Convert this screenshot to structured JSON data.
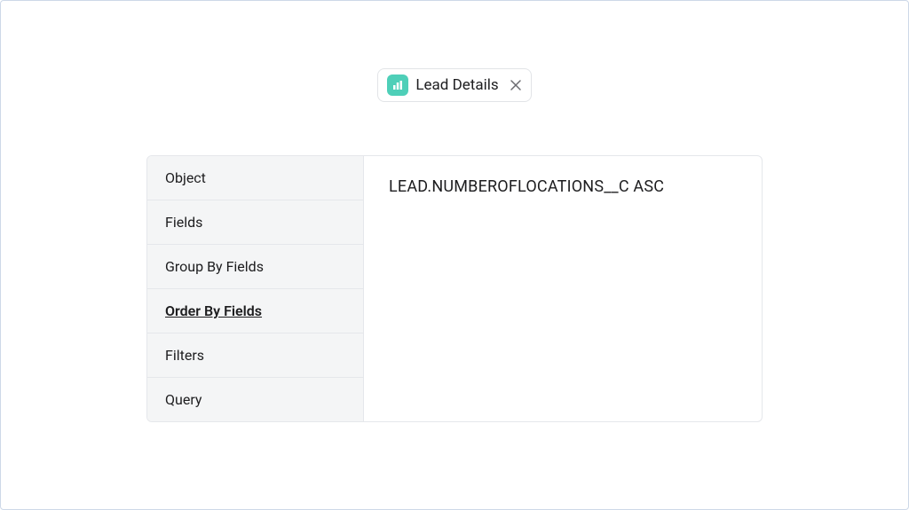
{
  "chip": {
    "label": "Lead Details",
    "icon_name": "chart-icon"
  },
  "sidebar": {
    "items": [
      {
        "label": "Object",
        "active": false
      },
      {
        "label": "Fields",
        "active": false
      },
      {
        "label": "Group By Fields",
        "active": false
      },
      {
        "label": "Order By Fields",
        "active": true
      },
      {
        "label": "Filters",
        "active": false
      },
      {
        "label": "Query",
        "active": false
      }
    ]
  },
  "content": {
    "text": "LEAD.NUMBEROFLOCATIONS__C ASC"
  }
}
